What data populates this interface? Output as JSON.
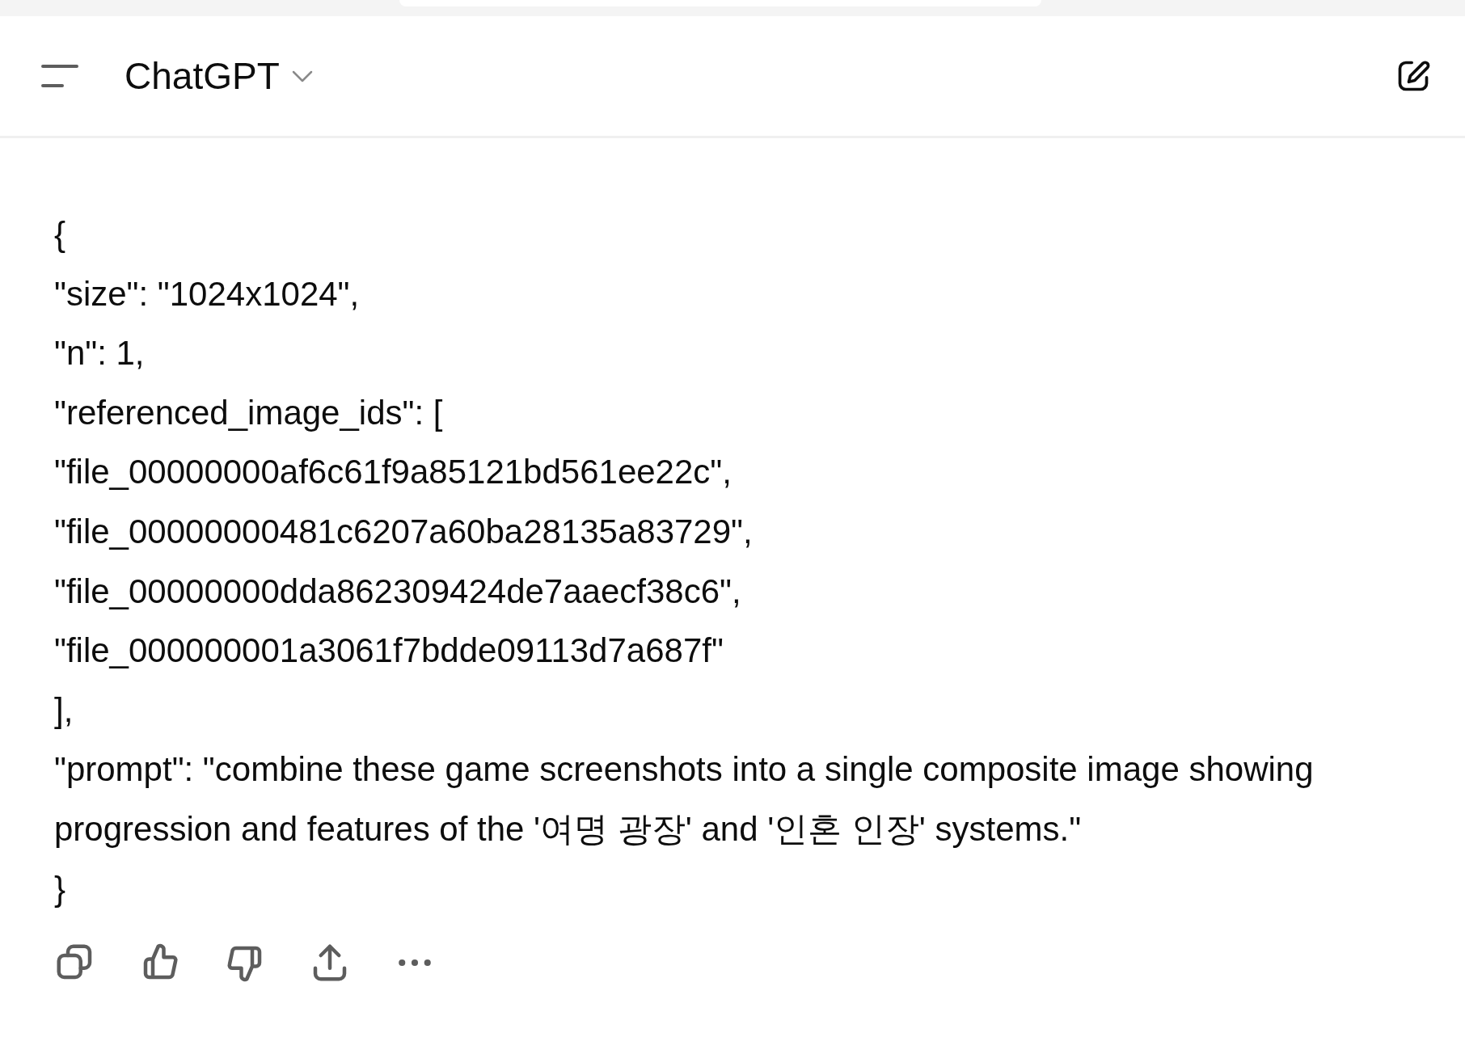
{
  "header": {
    "title": "ChatGPT"
  },
  "message": {
    "lines": [
      "{",
      "\"size\": \"1024x1024\",",
      "\"n\": 1,",
      "\"referenced_image_ids\": [",
      "\"file_00000000af6c61f9a85121bd561ee22c\",",
      "\"file_00000000481c6207a60ba28135a83729\",",
      "\"file_00000000dda862309424de7aaecf38c6\",",
      "\"file_000000001a3061f7bdde09113d7a687f\"",
      "],",
      "\"prompt\": \"combine these game screenshots into a single composite image showing progression and features of the '여명 광장' and '인혼 인장' systems.\"",
      "}"
    ]
  },
  "actions": [
    {
      "kind": "copy"
    },
    {
      "kind": "like"
    },
    {
      "kind": "dislike"
    },
    {
      "kind": "share"
    },
    {
      "kind": "more"
    }
  ]
}
